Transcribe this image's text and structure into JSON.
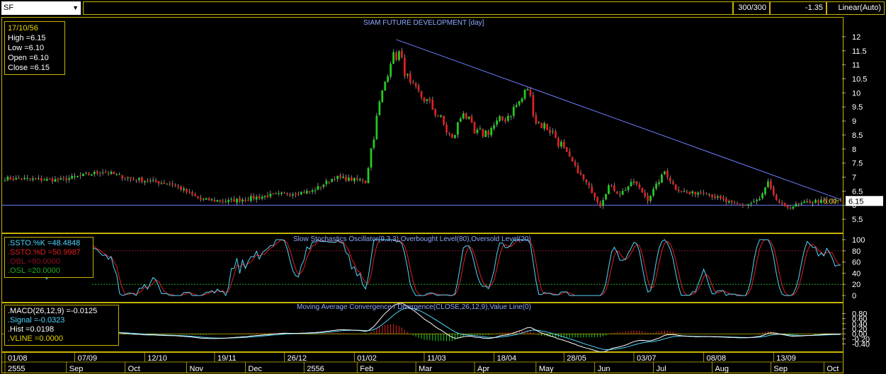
{
  "toolbar": {
    "symbol": "SF",
    "bars": "300/300",
    "change": "-1.35",
    "scale": "Linear(Auto)"
  },
  "info": {
    "date": "17/10/56",
    "high": "High  =6.15",
    "low": "Low   =6.10",
    "open": "Open  =6.10",
    "close": "Close  =6.15"
  },
  "price_panel": {
    "title": "SIAM FUTURE DEVELOPMENT [day]",
    "last_price": "6.15",
    "mark_label": "6.00"
  },
  "stoch_panel": {
    "title": "Slow Stochastics Oscillator(9,3,3),Overbought Level(80),Oversold Level(20)",
    "k": ".SSTO.%K   =48.4848",
    "d": ".SSTO.%D   =50.9987",
    "obl": ".OBL   =80.0000",
    "osl": ".OSL   =20.0000"
  },
  "macd_panel": {
    "title": "Moving Average Convergence / Divergence(CLOSE,26,12,9),Value Line(0)",
    "macd": ".MACD(26,12,9)   =-0.0125",
    "signal": ".Signal   =-0.0323",
    "hist": ".Hist   =0.0198",
    "vline": ".VLINE   =0.0000"
  },
  "colors": {
    "up": "#22cc22",
    "down": "#e02020",
    "frame": "#c8b400",
    "trend": "#6f7fff",
    "stoch_k": "#4fd6ff",
    "stoch_d": "#e02020",
    "macd": "#ffffff",
    "signal": "#4fd6ff"
  },
  "chart_data": [
    {
      "type": "candlestick",
      "title": "SIAM FUTURE DEVELOPMENT [day]",
      "ylim": [
        5.2,
        12.2
      ],
      "yticks": [
        5.5,
        6,
        6.5,
        7,
        7.5,
        8,
        8.5,
        9,
        9.5,
        10,
        10.5,
        11,
        11.5,
        12
      ],
      "dates": [
        "01/08",
        "07/09",
        "12/10",
        "19/11",
        "26/12",
        "01/02",
        "11/03",
        "18/04",
        "28/05",
        "03/07",
        "08/08",
        "13/09"
      ],
      "months": [
        "2555",
        "Sep",
        "Oct",
        "Nov",
        "Dec",
        "2556",
        "Feb",
        "Mar",
        "Apr",
        "May",
        "Jun",
        "Jul",
        "Aug",
        "Sep",
        "Oct"
      ],
      "close_keyframes": [
        [
          0,
          6.95
        ],
        [
          20,
          6.9
        ],
        [
          35,
          7.2
        ],
        [
          45,
          6.95
        ],
        [
          60,
          6.75
        ],
        [
          70,
          6.2
        ],
        [
          80,
          6.15
        ],
        [
          95,
          6.35
        ],
        [
          110,
          6.5
        ],
        [
          118,
          7.0
        ],
        [
          125,
          6.9
        ],
        [
          129,
          6.9
        ],
        [
          131,
          8.0
        ],
        [
          134,
          9.6
        ],
        [
          138,
          11.2
        ],
        [
          141,
          11.4
        ],
        [
          145,
          10.2
        ],
        [
          150,
          9.8
        ],
        [
          155,
          9.2
        ],
        [
          160,
          8.3
        ],
        [
          164,
          9.4
        ],
        [
          168,
          8.5
        ],
        [
          172,
          8.6
        ],
        [
          180,
          9.2
        ],
        [
          185,
          9.8
        ],
        [
          187,
          10.2
        ],
        [
          190,
          9.0
        ],
        [
          195,
          8.7
        ],
        [
          200,
          8.0
        ],
        [
          205,
          7.2
        ],
        [
          210,
          6.5
        ],
        [
          213,
          6.0
        ],
        [
          216,
          6.7
        ],
        [
          220,
          6.4
        ],
        [
          225,
          6.85
        ],
        [
          230,
          6.2
        ],
        [
          236,
          7.2
        ],
        [
          240,
          6.6
        ],
        [
          245,
          6.4
        ],
        [
          250,
          6.5
        ],
        [
          255,
          6.25
        ],
        [
          260,
          6.05
        ],
        [
          265,
          6.0
        ],
        [
          270,
          6.2
        ],
        [
          273,
          6.8
        ],
        [
          275,
          6.3
        ],
        [
          279,
          5.9
        ],
        [
          285,
          6.05
        ],
        [
          290,
          6.15
        ]
      ],
      "trendline": [
        [
          140,
          11.9
        ],
        [
          299,
          6.2
        ]
      ],
      "support": 6.0,
      "last_close": 6.15
    },
    {
      "type": "line",
      "title": "Slow Stochastics Oscillator(9,3,3),Overbought Level(80),Oversold Level(20)",
      "ylim": [
        0,
        100
      ],
      "yticks": [
        0,
        20,
        40,
        60,
        80,
        100
      ],
      "levels": [
        80,
        20
      ],
      "series": [
        {
          "name": ".SSTO.%K",
          "last": 48.4848
        },
        {
          "name": ".SSTO.%D",
          "last": 50.9987
        }
      ]
    },
    {
      "type": "line",
      "title": "Moving Average Convergence / Divergence(CLOSE,26,12,9),Value Line(0)",
      "ylim": [
        -0.5,
        0.9
      ],
      "yticks": [
        -0.4,
        -0.2,
        0.0,
        0.2,
        0.4,
        0.6,
        0.8
      ],
      "series": [
        {
          "name": ".MACD(26,12,9)",
          "last": -0.0125
        },
        {
          "name": ".Signal",
          "last": -0.0323
        },
        {
          "name": ".Hist",
          "last": 0.0198
        }
      ]
    }
  ]
}
